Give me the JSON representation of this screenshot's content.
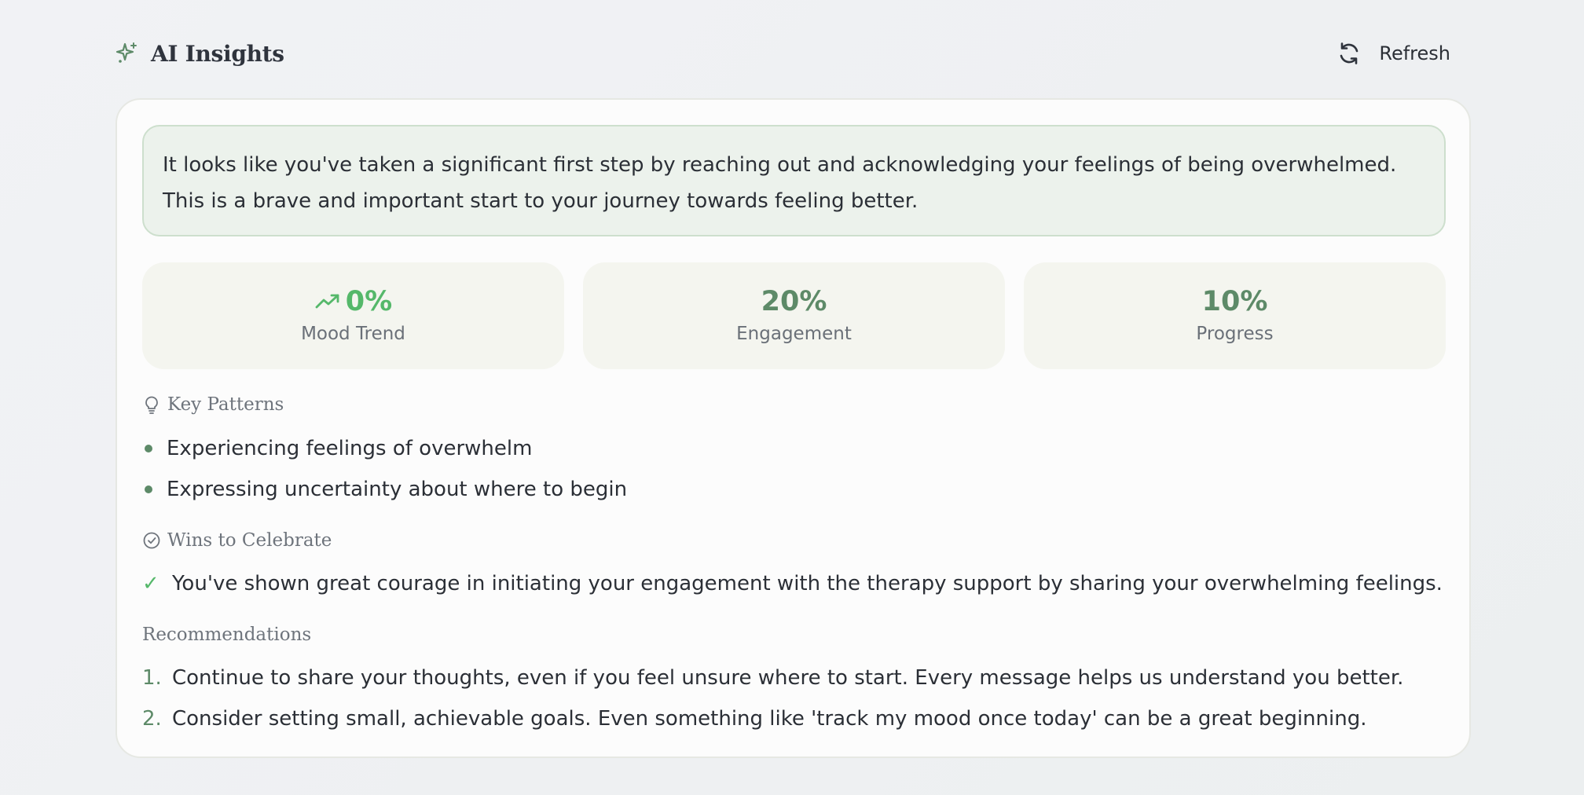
{
  "header": {
    "title": "AI Insights",
    "title_icon": "sparkle-icon",
    "refresh_label": "Refresh",
    "refresh_icon": "refresh-icon"
  },
  "summary": {
    "text": "It looks like you've taken a significant first step by reaching out and acknowledging your feelings of being overwhelmed. This is a brave and important start to your journey towards feeling better."
  },
  "stats": [
    {
      "value": "0%",
      "label": "Mood Trend",
      "icon": "trending-up-icon"
    },
    {
      "value": "20%",
      "label": "Engagement"
    },
    {
      "value": "10%",
      "label": "Progress"
    }
  ],
  "key_patterns": {
    "heading": "Key Patterns",
    "icon": "lightbulb-icon",
    "items": [
      "Experiencing feelings of overwhelm",
      "Expressing uncertainty about where to begin"
    ]
  },
  "wins": {
    "heading": "Wins to Celebrate",
    "icon": "check-circle-icon",
    "check_glyph": "✓",
    "items": [
      "You've shown great courage in initiating your engagement with the therapy support by sharing your overwhelming feelings."
    ]
  },
  "recommendations": {
    "heading": "Recommendations",
    "items": [
      {
        "number": "1.",
        "text": "Continue to share your thoughts, even if you feel unsure where to start. Every message helps us understand you better."
      },
      {
        "number": "2.",
        "text": "Consider setting small, achievable goals. Even something like 'track my mood once today' can be a great beginning."
      }
    ]
  },
  "colors": {
    "accent_green": "#5d8a68",
    "positive_green": "#55b86a",
    "summary_bg": "#ecf2ec",
    "stat_bg": "#f4f5ef"
  }
}
